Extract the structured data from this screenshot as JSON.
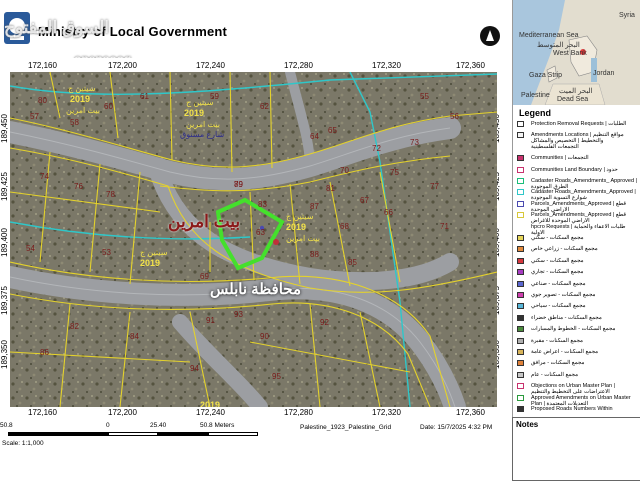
{
  "header": {
    "title": "Ministry of Local Government",
    "watermark_ar": "السوق المفتوح",
    "watermark_en": "opensooq"
  },
  "inset": {
    "labels": [
      "Syria",
      "Mediterranean Sea",
      "البحر المتوسط",
      "West Bank",
      "Gaza Strip",
      "Jordan",
      "Palestine",
      "Dead Sea",
      "البحر الميت"
    ]
  },
  "map": {
    "x_ticks_top": [
      "172,160",
      "172,200",
      "172,240",
      "172,280",
      "172,320",
      "172,360"
    ],
    "x_ticks_bottom": [
      "172,160",
      "172,200",
      "172,240",
      "172,280",
      "172,320",
      "172,360"
    ],
    "y_ticks_left": [
      "189,450",
      "189,425",
      "189,400",
      "189,375",
      "189,350"
    ],
    "y_ticks_right": [
      "189,450",
      "189,425",
      "189,400",
      "189,375",
      "189,350"
    ],
    "labels": {
      "governorate": "محافظة نابلس",
      "village": "بيت امرين",
      "road_label": "شارع مسنوق",
      "year_label": "2019",
      "parcel_label": "سيتين ج",
      "village_small": "بيت امرين"
    },
    "parcel_numbers": [
      "80",
      "74",
      "76",
      "78",
      "79",
      "81",
      "82",
      "83",
      "84",
      "85",
      "86",
      "87",
      "88",
      "89",
      "90",
      "91",
      "92",
      "93",
      "94",
      "95",
      "64",
      "66",
      "68",
      "69",
      "70",
      "72",
      "73",
      "75",
      "77",
      "67",
      "63",
      "65",
      "71",
      "60",
      "61",
      "62",
      "57",
      "58",
      "59",
      "55",
      "56",
      "54",
      "53"
    ],
    "colors": {
      "imagery": "#7d7a6c",
      "road": "#9a9c9e",
      "parcel_line": "#e6d42a",
      "boundary_cyan": "#2fc7c9",
      "highlight": "#44e02c",
      "label_red": "#8b1a1a"
    }
  },
  "legend": {
    "title": "Legend",
    "items": [
      {
        "label": "Protection Removal Requests | الطلبات",
        "color": "#ffffff",
        "border": "#333333"
      },
      {
        "label": "Amendments Locations | مواقع التنظيم والتخطيط | التخصيص والمشاكل",
        "color": "#f4f4f4",
        "border": "#333333"
      },
      {
        "label": "التجمعات الفلسطينية",
        "color": "#ffffff",
        "border": "#ffffff"
      },
      {
        "label": "Communities | التجمعات",
        "color": "#c8326e",
        "border": "#333333"
      },
      {
        "label": "Communities Land Boundary | حدود",
        "color": "#ffffff",
        "border": "#c8326e"
      },
      {
        "label": "Cadaster Roads_Amendments_ Approved | الطرق الموجودة",
        "color": "#ffffff",
        "border": "#1bbd7a"
      },
      {
        "label": "Cadaster Roads_Amendments_Approved | شوارع التسوية الموجودة",
        "color": "#ffffff",
        "border": "#2fc7c9"
      },
      {
        "label": "Parcels_Amendments_Approved | قطع الاراضي الموحدة",
        "color": "#ffffff",
        "border": "#4a4ab0"
      },
      {
        "label": "Parcels_Amendments_Approved | قطع الاراضي الموحدة للاغراض",
        "color": "#ffffff",
        "border": "#d8c83a"
      },
      {
        "label": "hpcro Requests | طلبات الاعفاء والحماية الاولية",
        "color": "#ffffff",
        "border": "#ffffff"
      },
      {
        "label": "مجمع السكنات - سكني",
        "color": "#e7d65a",
        "border": "#333333"
      },
      {
        "label": "مجمع السكنات - زراعي خاص",
        "color": "#e28a3c",
        "border": "#333333"
      },
      {
        "label": "مجمع السكنات - سكني",
        "color": "#d7373e",
        "border": "#333333"
      },
      {
        "label": "مجمع السكنات - تجاري",
        "color": "#a73cc2",
        "border": "#333333"
      },
      {
        "label": "مجمع السكنات - صناعي",
        "color": "#5a66d0",
        "border": "#333333"
      },
      {
        "label": "مجمع السكنات - تصوير جوي",
        "color": "#cf3fae",
        "border": "#333333"
      },
      {
        "label": "مجمع السكنات - سياحي",
        "color": "#58b6d8",
        "border": "#333333"
      },
      {
        "label": "مجمع السكنات - مناطق خضراء",
        "color": "#333333",
        "border": "#333333"
      },
      {
        "label": "مجمع السكنات - الخطوط والمسارات",
        "color": "#4a8b3c",
        "border": "#333333"
      },
      {
        "label": "مجمع السكنات - مقبرة",
        "color": "#b0b0b0",
        "border": "#333333"
      },
      {
        "label": "مجمع السكنات - اعراض عامة",
        "color": "#d8b45a",
        "border": "#333333"
      },
      {
        "label": "مجمع السكنات - مرافق",
        "color": "#e0823a",
        "border": "#333333"
      },
      {
        "label": "مجمع السكنات - عام",
        "color": "#c8c8c8",
        "border": "#333333"
      },
      {
        "label": "Objections on Urban Master Plan | الاعتراضات على التخطيط والتنظيم",
        "color": "#ffffff",
        "border": "#c8326e"
      },
      {
        "label": "Approved Amendments on Urban Master Plan | التعديلات المعتمدة",
        "color": "#ffffff",
        "border": "#2a9a3c"
      },
      {
        "label": "Proposed Roads Numbers Within",
        "color": "#333333",
        "border": "#333333"
      }
    ]
  },
  "scale": {
    "labels": [
      "50.8",
      "0",
      "25.40",
      "50.8 Meters"
    ],
    "ratio_label": "Scale: 1:1,000"
  },
  "footer": {
    "grid_label": "Palestine_1923_Palestine_Grid",
    "date_label": "Date: 15/7/2025 4:32 PM"
  },
  "notes": {
    "label": "Notes"
  }
}
